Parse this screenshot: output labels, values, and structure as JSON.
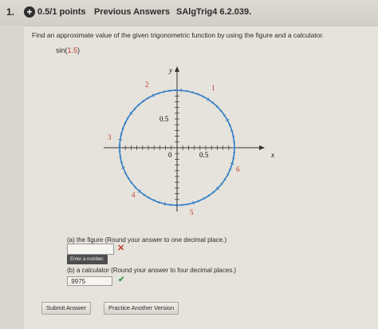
{
  "header": {
    "question_number": "1.",
    "points": "0.5/1 points",
    "previous_answers": "Previous Answers",
    "problem_code": "SAlgTrig4 6.2.039."
  },
  "question": {
    "prompt": "Find an approximate value of the given trigonometric function by using the figure and a calculator.",
    "function_name": "sin(",
    "function_arg": "1.5",
    "function_close": ")"
  },
  "figure": {
    "y_axis_label": "y",
    "x_axis_label": "x",
    "tick_label_y": "0.5",
    "tick_label_x": "0.5",
    "origin_label": "0",
    "arc_labels": [
      "1",
      "2",
      "3",
      "4",
      "5",
      "6"
    ]
  },
  "part_a": {
    "label": "(a) the figure (Round your answer to one decimal place.)",
    "value": "",
    "tooltip": "Enter a number."
  },
  "part_b": {
    "label": "(b) a calculator (Round your answer to four decimal places.)",
    "value": ".9975"
  },
  "buttons": {
    "submit": "Submit Answer",
    "practice": "Practice Another Version"
  },
  "colors": {
    "circle": "#2e7bc4",
    "arc_label": "#c0392b",
    "correct": "#3a9a3a",
    "incorrect": "#c0392b"
  }
}
